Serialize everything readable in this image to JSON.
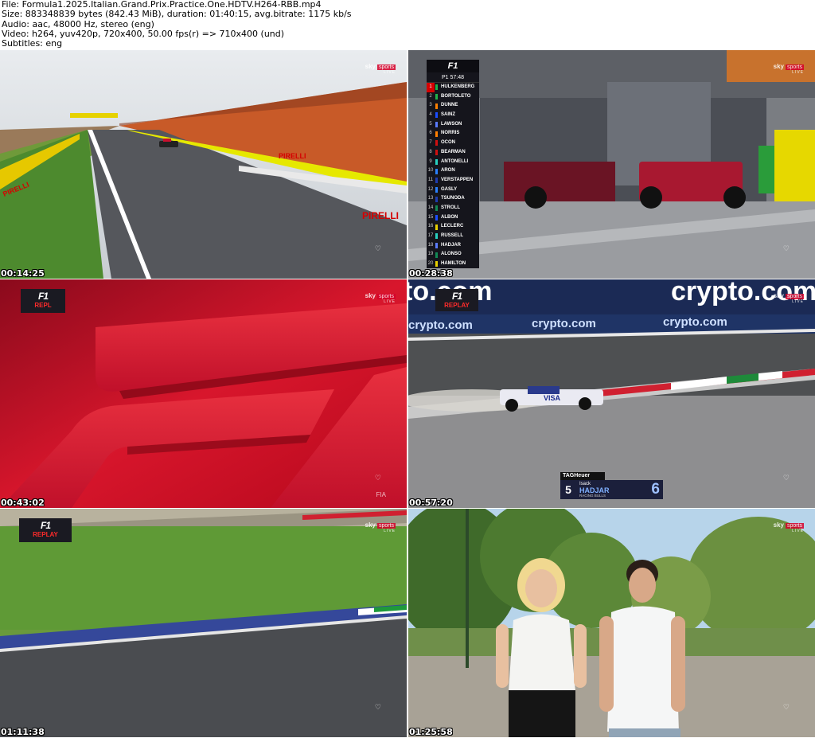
{
  "info": {
    "file": "File: Formula1.2025.Italian.Grand.Prix.Practice.One.HDTV.H264-RBB.mp4",
    "size": "Size: 883348839 bytes (842.43 MiB), duration: 01:40:15, avg.bitrate: 1175 kb/s",
    "audio": "Audio: aac, 48000 Hz, stereo (eng)",
    "video": "Video: h264, yuv420p, 720x400, 50.00 fps(r) => 710x400 (und)",
    "subtitles": "Subtitles: eng"
  },
  "thumbnails": [
    {
      "timestamp": "00:14:25"
    },
    {
      "timestamp": "00:28:38"
    },
    {
      "timestamp": "00:43:02"
    },
    {
      "timestamp": "00:57:20"
    },
    {
      "timestamp": "01:11:38"
    },
    {
      "timestamp": "01:25:58"
    }
  ],
  "overlays": {
    "sky_brand": "sky",
    "sky_sports": "sports",
    "sky_live": "LIVE",
    "f1_logo": "F1",
    "replay": "REPLAY",
    "replay_cut": "REPL",
    "heart": "♡",
    "fia": "FIA"
  },
  "timing_tower": {
    "session_clock": "P1 57:48",
    "drivers": [
      {
        "pos": "1",
        "name": "HULKENBERG",
        "color": "#1fb24a"
      },
      {
        "pos": "2",
        "name": "BORTOLETO",
        "color": "#1fb24a"
      },
      {
        "pos": "3",
        "name": "DUNNE",
        "color": "#ff8000"
      },
      {
        "pos": "4",
        "name": "SAINZ",
        "color": "#1a4dff"
      },
      {
        "pos": "5",
        "name": "LAWSON",
        "color": "#5a7bff"
      },
      {
        "pos": "6",
        "name": "NORRIS",
        "color": "#ff8000"
      },
      {
        "pos": "7",
        "name": "OCON",
        "color": "#d01010"
      },
      {
        "pos": "8",
        "name": "BEARMAN",
        "color": "#d01010"
      },
      {
        "pos": "9",
        "name": "ANTONELLI",
        "color": "#28d0c0"
      },
      {
        "pos": "10",
        "name": "ARON",
        "color": "#2a80ff"
      },
      {
        "pos": "11",
        "name": "VERSTAPPEN",
        "color": "#1e3cb0"
      },
      {
        "pos": "12",
        "name": "GASLY",
        "color": "#2a80ff"
      },
      {
        "pos": "13",
        "name": "TSUNODA",
        "color": "#1e3cb0"
      },
      {
        "pos": "14",
        "name": "STROLL",
        "color": "#118a55"
      },
      {
        "pos": "15",
        "name": "ALBON",
        "color": "#1a4dff"
      },
      {
        "pos": "16",
        "name": "LECLERC",
        "color": "#e8d000"
      },
      {
        "pos": "17",
        "name": "RUSSELL",
        "color": "#28d0c0"
      },
      {
        "pos": "18",
        "name": "HADJAR",
        "color": "#5a7bff"
      },
      {
        "pos": "19",
        "name": "ALONSO",
        "color": "#118a55"
      },
      {
        "pos": "20",
        "name": "HAMILTON",
        "color": "#e8d000"
      }
    ]
  },
  "lower_third": {
    "sponsor": "TAGHeuer",
    "number": "5",
    "first_name": "Isack",
    "last_name": "HADJAR",
    "team": "RACING BULLS",
    "car_number": "6"
  },
  "ads": {
    "pirelli": "PIRELLI",
    "crypto": "crypto.com",
    "crypto_partial": "to.com",
    "visa": "VISA"
  }
}
